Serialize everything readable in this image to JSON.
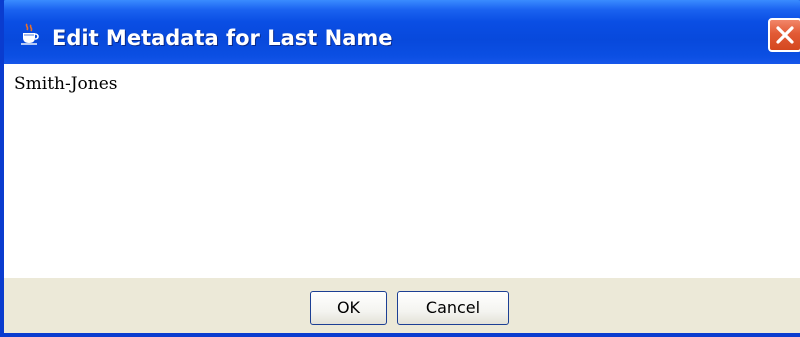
{
  "window": {
    "title": "Edit Metadata for Last Name",
    "title_icon": "java-coffee-cup-icon",
    "close_icon": "close-icon"
  },
  "editor": {
    "value": "Smith-Jones"
  },
  "buttons": {
    "ok_label": "OK",
    "cancel_label": "Cancel"
  },
  "colors": {
    "titlebar": "#0a4ee4",
    "close_button": "#e25a35",
    "button_bar": "#ece9d8",
    "content_background": "#ffffff"
  }
}
